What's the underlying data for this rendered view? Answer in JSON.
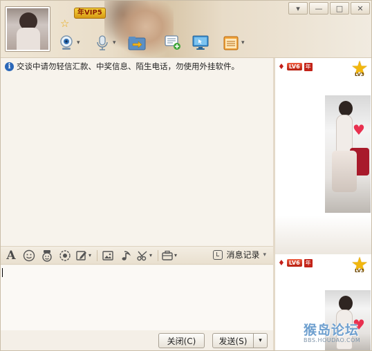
{
  "header": {
    "vip_badge": "年VIP5",
    "toolbar_icons": [
      "webcam-icon",
      "microphone-icon",
      "transfer-file-icon",
      "sms-icon",
      "remote-desktop-icon",
      "app-box-icon"
    ]
  },
  "window_controls": {
    "dropdown": "▾",
    "minimize": "—",
    "maximize": "□",
    "close": "✕"
  },
  "chat": {
    "notice": "交谈中请勿轻信汇款、中奖信息、陌生电话，勿使用外挂软件。"
  },
  "format_toolbar": {
    "font_glyph": "A",
    "history_label": "消息记录",
    "history_arrow": "▾"
  },
  "buttons": {
    "close_label": "关闭(C)",
    "send_label": "发送(S)",
    "send_dropdown": "▾"
  },
  "side_panel": {
    "cards": [
      {
        "level": "LV6",
        "year_badge": "年",
        "star_level": "LV3"
      },
      {
        "level": "LV6",
        "year_badge": "年",
        "star_level": "LV3"
      }
    ]
  },
  "watermark": {
    "title": "猴岛论坛",
    "url": "BBS.HOUDAO.COM"
  }
}
